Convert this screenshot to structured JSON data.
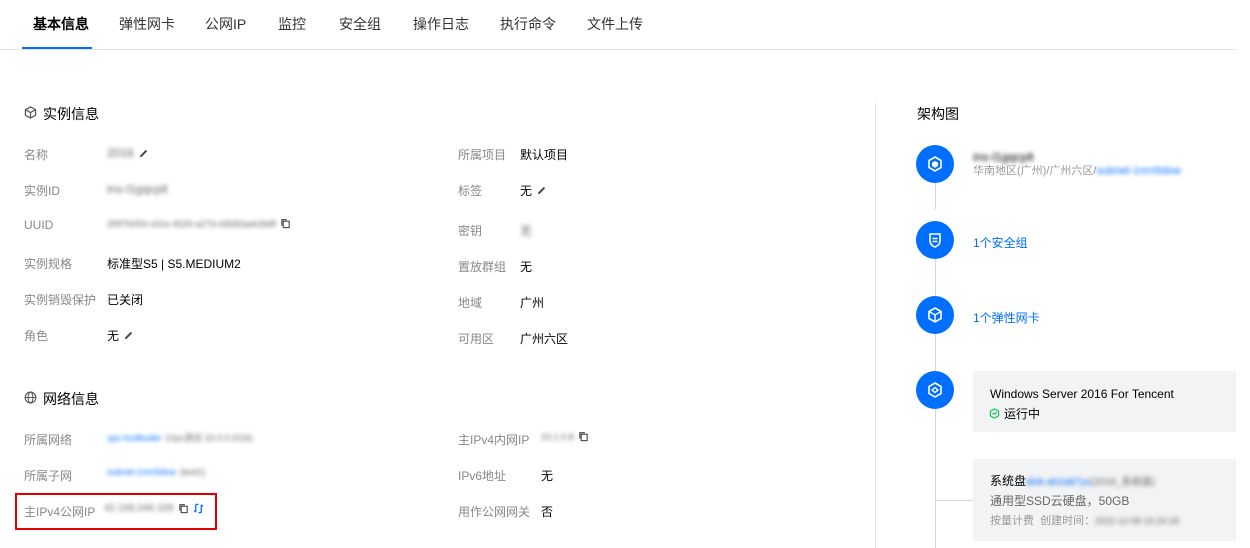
{
  "tabs": [
    {
      "label": "基本信息"
    },
    {
      "label": "弹性网卡"
    },
    {
      "label": "公网IP"
    },
    {
      "label": "监控"
    },
    {
      "label": "安全组"
    },
    {
      "label": "操作日志"
    },
    {
      "label": "执行命令"
    },
    {
      "label": "文件上传"
    }
  ],
  "instance": {
    "title": "实例信息",
    "name": {
      "label": "名称",
      "value": "2016"
    },
    "id": {
      "label": "实例ID",
      "value": "ins-l1gqcplt"
    },
    "uuid": {
      "label": "UUID",
      "value": "2f9f7b054-c61e-4526-a27d-d3b82aeb3b8f"
    },
    "spec": {
      "label": "实例规格",
      "value": "标准型S5 | S5.MEDIUM2"
    },
    "protect": {
      "label": "实例销毁保护",
      "value": "已关闭"
    },
    "role": {
      "label": "角色",
      "value": "无"
    },
    "project": {
      "label": "所属项目",
      "value": "默认项目"
    },
    "tags": {
      "label": "标签",
      "value": "无"
    },
    "key": {
      "label": "密钥",
      "value": "无"
    },
    "group": {
      "label": "置放群组",
      "value": "无"
    },
    "region": {
      "label": "地域",
      "value": "广州"
    },
    "zone": {
      "label": "可用区",
      "value": "广州六区"
    }
  },
  "network": {
    "title": "网络信息",
    "vpc": {
      "label": "所属网络",
      "value": "vpc-hcdbuder",
      "extra": "(Vpc测试 10.0.0.0/16)"
    },
    "subnet": {
      "label": "所属子网",
      "value": "subnet-1nrn5dxw",
      "extra": "(test1)"
    },
    "public_ip": {
      "label": "主IPv4公网IP",
      "value": "42.193.246.109"
    },
    "private_ip": {
      "label": "主IPv4内网IP",
      "value": "10.1.0.8"
    },
    "ipv6": {
      "label": "IPv6地址",
      "value": "无"
    },
    "gateway": {
      "label": "用作公网网关",
      "value": "否"
    }
  },
  "arch": {
    "title": "架构图",
    "vpc_name": "ins-l1gqcplt",
    "vpc_region_prefix": "华南地区(广州)/广州六区/",
    "vpc_subnet": "subnet-1nrn5dxw",
    "security_group": "1个安全组",
    "eni": "1个弹性网卡",
    "os": "Windows Server 2016 For Tencent",
    "status": "运行中",
    "disk_prefix": "系统盘",
    "disk_id": "disk-ah2a87ys",
    "disk_suffix": "(2016_系统盘)",
    "disk_type": "通用型SSD云硬盘，50GB",
    "billing": "按量计费",
    "created_label": "创建时间：",
    "created_value": "2022-12-08 16:24:18"
  },
  "colors": {
    "accent": "#006eff",
    "highlight": "#e00000",
    "status_ok": "#0abf5b"
  }
}
